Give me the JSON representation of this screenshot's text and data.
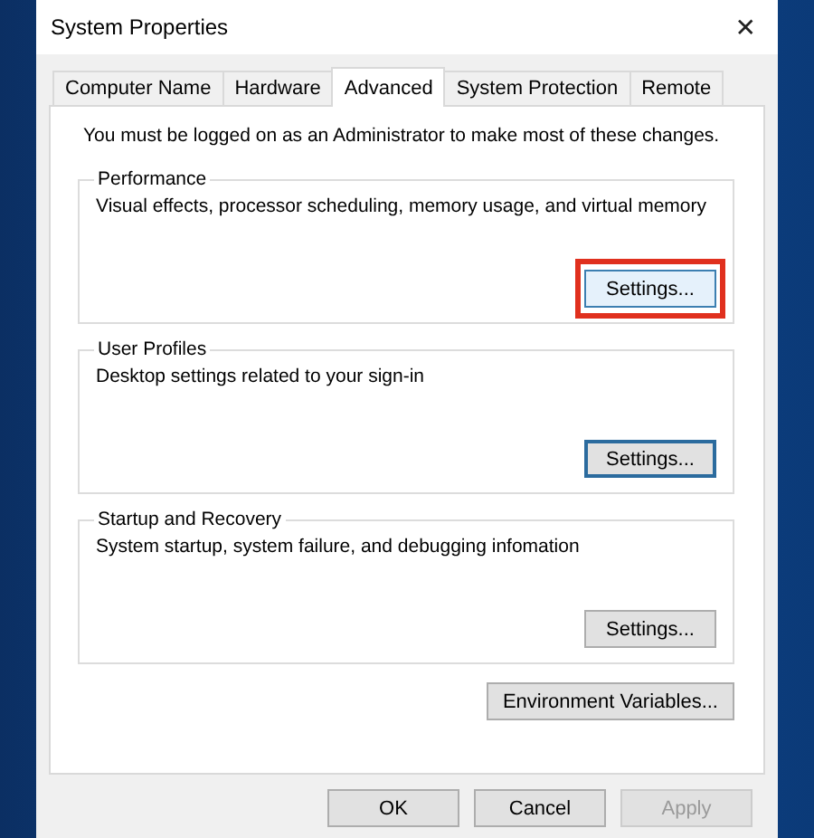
{
  "window": {
    "title": "System Properties",
    "close": "✕"
  },
  "tabs": [
    {
      "label": "Computer Name",
      "selected": false
    },
    {
      "label": "Hardware",
      "selected": false
    },
    {
      "label": "Advanced",
      "selected": true
    },
    {
      "label": "System Protection",
      "selected": false
    },
    {
      "label": "Remote",
      "selected": false
    }
  ],
  "notice": "You must be logged on as an Administrator to make most of these changes.",
  "groups": [
    {
      "title": "Performance",
      "description": "Visual effects, processor scheduling, memory usage, and virtual memory",
      "button": {
        "label": "Settings...",
        "highlighted": true,
        "focused": false
      }
    },
    {
      "title": "User Profiles",
      "description": "Desktop settings related to your sign-in",
      "button": {
        "label": "Settings...",
        "highlighted": false,
        "focused": true
      }
    },
    {
      "title": "Startup and Recovery",
      "description": "System startup, system failure, and debugging infomation",
      "button": {
        "label": "Settings...",
        "highlighted": false,
        "focused": false
      }
    }
  ],
  "environment_button": "Environment Variables...",
  "buttons": [
    {
      "label": "OK",
      "disabled": false
    },
    {
      "label": "Cancel",
      "disabled": false
    },
    {
      "label": "Apply",
      "disabled": true
    }
  ]
}
